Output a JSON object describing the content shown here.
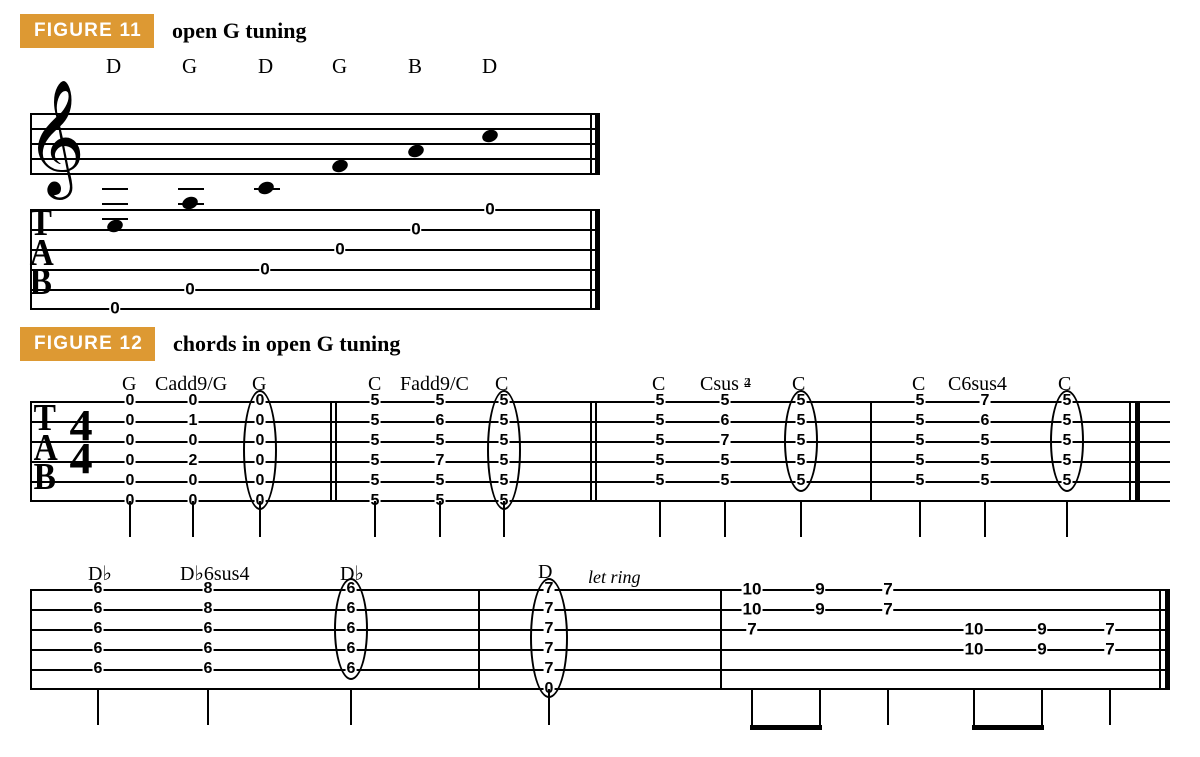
{
  "figure11": {
    "label": "FIGURE 11",
    "title": "open G tuning",
    "note_names": [
      "D",
      "G",
      "D",
      "G",
      "B",
      "D"
    ],
    "tab_label": "T\nA\nB",
    "tab_values": [
      "0",
      "0",
      "0",
      "0",
      "0",
      "0"
    ]
  },
  "figure12": {
    "label": "FIGURE 12",
    "title": "chords in open G tuning",
    "tab_clef": "T\nA\nB",
    "time_sig_top": "4",
    "time_sig_bot": "4",
    "row1": {
      "chord_names": [
        "G",
        "Cadd9/G",
        "G",
        "C",
        "Fadd9/C",
        "C",
        "C",
        "Csus",
        "C",
        "C",
        "C6sus4",
        "C"
      ],
      "sus_fraction": {
        "top": "4",
        "bot": "2"
      },
      "columns": [
        {
          "frets": [
            "0",
            "0",
            "0",
            "0",
            "0",
            "0"
          ],
          "strings": 6
        },
        {
          "frets": [
            "0",
            "1",
            "0",
            "2",
            "0",
            "0"
          ],
          "strings": 6
        },
        {
          "frets": [
            "0",
            "0",
            "0",
            "0",
            "0",
            "0"
          ],
          "strings": 6,
          "circled": true
        },
        {
          "frets": [
            "5",
            "5",
            "5",
            "5",
            "5",
            "5"
          ],
          "strings": 6
        },
        {
          "frets": [
            "5",
            "6",
            "5",
            "7",
            "5",
            "5"
          ],
          "strings": 6
        },
        {
          "frets": [
            "5",
            "5",
            "5",
            "5",
            "5",
            "5"
          ],
          "strings": 6,
          "circled": true
        },
        {
          "frets": [
            "5",
            "5",
            "5",
            "5",
            "5"
          ],
          "strings": 5
        },
        {
          "frets": [
            "5",
            "6",
            "7",
            "5",
            "5"
          ],
          "strings": 5
        },
        {
          "frets": [
            "5",
            "5",
            "5",
            "5",
            "5"
          ],
          "strings": 5,
          "circled": true
        },
        {
          "frets": [
            "5",
            "5",
            "5",
            "5",
            "5"
          ],
          "strings": 5
        },
        {
          "frets": [
            "7",
            "6",
            "5",
            "5",
            "5"
          ],
          "strings": 5
        },
        {
          "frets": [
            "5",
            "5",
            "5",
            "5",
            "5"
          ],
          "strings": 5,
          "circled": true
        }
      ]
    },
    "row2": {
      "chord_names": [
        "D♭",
        "D♭6sus4",
        "D♭",
        "D"
      ],
      "let_ring": "let ring",
      "columns": [
        {
          "frets": [
            "6",
            "6",
            "6",
            "6",
            "6"
          ],
          "strings": 5
        },
        {
          "frets": [
            "8",
            "8",
            "6",
            "6",
            "6"
          ],
          "strings": 5
        },
        {
          "frets": [
            "6",
            "6",
            "6",
            "6",
            "6"
          ],
          "strings": 5,
          "circled": true
        },
        {
          "frets": [
            "7",
            "7",
            "7",
            "7",
            "7",
            "0"
          ],
          "strings": 6,
          "circled": true
        }
      ],
      "riff": [
        {
          "notes": [
            {
              "s": 1,
              "f": "10"
            },
            {
              "s": 2,
              "f": "10"
            },
            {
              "s": 3,
              "f": "7"
            }
          ]
        },
        {
          "notes": [
            {
              "s": 1,
              "f": "9"
            },
            {
              "s": 2,
              "f": "9"
            }
          ]
        },
        {
          "notes": [
            {
              "s": 1,
              "f": "7"
            },
            {
              "s": 2,
              "f": "7"
            }
          ]
        },
        {
          "notes": [
            {
              "s": 3,
              "f": "10"
            },
            {
              "s": 4,
              "f": "10"
            }
          ]
        },
        {
          "notes": [
            {
              "s": 3,
              "f": "9"
            },
            {
              "s": 4,
              "f": "9"
            }
          ]
        },
        {
          "notes": [
            {
              "s": 3,
              "f": "7"
            },
            {
              "s": 4,
              "f": "7"
            }
          ]
        }
      ]
    }
  }
}
